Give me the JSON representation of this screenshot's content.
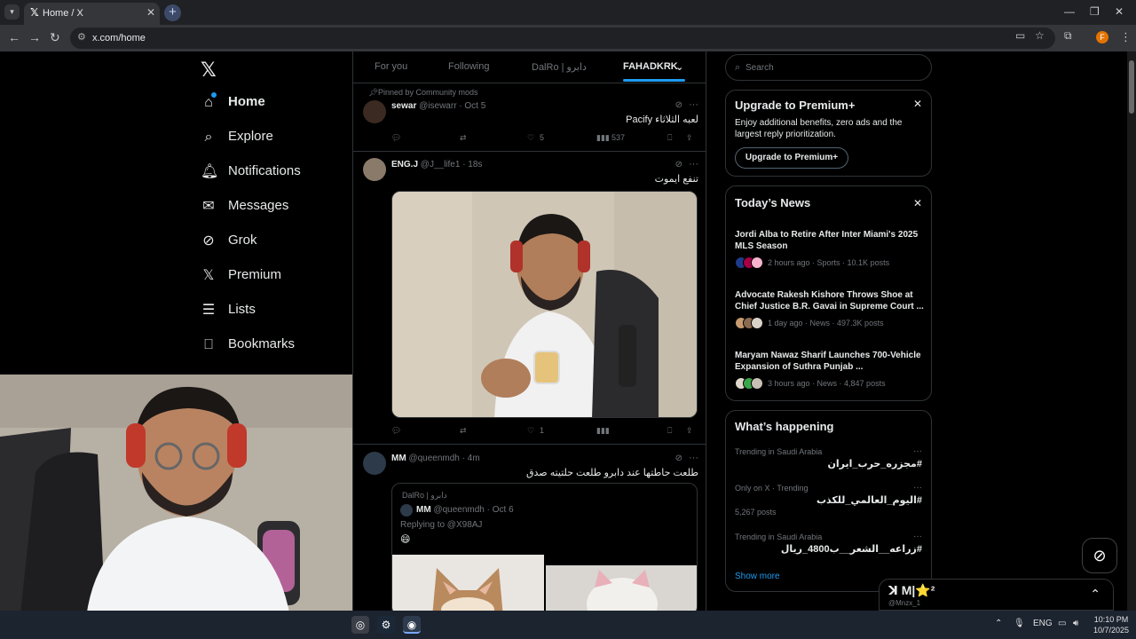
{
  "browser": {
    "tab_title": "Home / X",
    "tab_favicon": "x-logo-icon",
    "new_tab": "+",
    "url": "x.com/home",
    "window_controls": [
      "—",
      "❐",
      "✕"
    ],
    "profile_initial": "F"
  },
  "nav": {
    "logo": "𝕏",
    "items": [
      {
        "label": "Home",
        "icon": "home-icon",
        "glyph": "⌂"
      },
      {
        "label": "Explore",
        "icon": "search-icon",
        "glyph": "⌕"
      },
      {
        "label": "Notifications",
        "icon": "bell-icon",
        "glyph": "🔔︎"
      },
      {
        "label": "Messages",
        "icon": "mail-icon",
        "glyph": "✉"
      },
      {
        "label": "Grok",
        "icon": "grok-icon",
        "glyph": "⊘"
      },
      {
        "label": "Premium",
        "icon": "x-logo-icon",
        "glyph": "𝕏"
      },
      {
        "label": "Lists",
        "icon": "list-icon",
        "glyph": "☰"
      },
      {
        "label": "Bookmarks",
        "icon": "bookmark-icon",
        "glyph": "⎕"
      }
    ]
  },
  "feed": {
    "tabs": [
      "For you",
      "Following",
      "DalRo | دابرو",
      "FAHADKRK"
    ],
    "active_tab": "FAHADKRK",
    "posts": [
      {
        "pinned_label": "Pinned by Community mods",
        "name": "sewar",
        "handle_time": "@isewarr · Oct 5",
        "text": "لعبه الثلاثاء Pacify",
        "likes": "5",
        "views": "537"
      },
      {
        "name": "ENG.J",
        "handle_time": "@J__life1 · 18s",
        "text": "تنفع ايموت",
        "likes": "1"
      },
      {
        "name": "MM",
        "handle_time": "@queenmdh · 4m",
        "text": "طلعت حاطتها عند دابرو طلعت حلتيته صدق",
        "quote": {
          "community": "DalRo | دابرو",
          "name": "MM",
          "handle_time": "@queenmdh · Oct 6",
          "replying": "Replying to @X98AJ",
          "emoji": "😄"
        }
      }
    ]
  },
  "search": {
    "placeholder": "Search"
  },
  "premium_card": {
    "title": "Upgrade to Premium+",
    "text": "Enjoy additional benefits, zero ads and the largest reply prioritization.",
    "button": "Upgrade to Premium+"
  },
  "news_card": {
    "title": "Today’s News",
    "items": [
      {
        "title": "Jordi Alba to Retire After Inter Miami's 2025 MLS Season",
        "meta": "2 hours ago · Sports · 10.1K posts"
      },
      {
        "title": "Advocate Rakesh Kishore Throws Shoe at Chief Justice B.R. Gavai in Supreme Court ...",
        "meta": "1 day ago · News · 497.3K posts"
      },
      {
        "title": "Maryam Nawaz Sharif Launches 700-Vehicle Expansion of Suthra Punjab ...",
        "meta": "3 hours ago · News · 4,847 posts"
      }
    ]
  },
  "happening_card": {
    "title": "What’s happening",
    "trends": [
      {
        "category": "Trending in Saudi Arabia",
        "name": "#مجزره_حرب_ايران",
        "posts": ""
      },
      {
        "category": "Only on X · Trending",
        "name": "#اليوم_العالمي_للكذب",
        "posts": "5,267 posts"
      },
      {
        "category": "Trending in Saudi Arabia",
        "name": "#زراعه__الشعر__ب4800_ريال",
        "posts": ""
      }
    ],
    "show_more": "Show more"
  },
  "messages_drawer": {
    "name": "ꓘ M|⭐²",
    "handle": "@Mnzx_1"
  },
  "taskbar": {
    "lang": "ENG",
    "time": "10:10 PM",
    "date": "10/7/2025"
  },
  "colors": {
    "accent": "#1d9bf0",
    "background": "#000000",
    "border": "#2f3336",
    "muted": "#71767b"
  }
}
